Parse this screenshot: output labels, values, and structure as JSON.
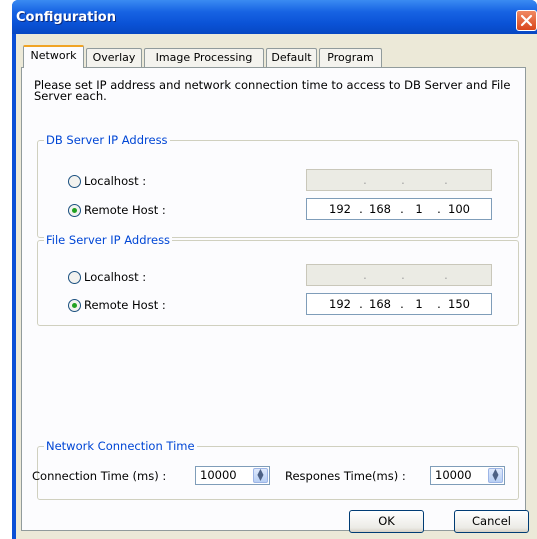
{
  "window": {
    "title": "Configuration"
  },
  "tabs": [
    {
      "label": "Network"
    },
    {
      "label": "Overlay"
    },
    {
      "label": "Image Processing"
    },
    {
      "label": "Default"
    },
    {
      "label": "Program"
    }
  ],
  "network": {
    "description": "Please set IP address and network connection time to access to DB Server and File Server each.",
    "db_server": {
      "group_title": "DB Server IP Address",
      "localhost_label": "Localhost :",
      "remote_label": "Remote Host :",
      "selected": "remote",
      "local_ip": [
        ".",
        ".",
        "."
      ],
      "remote_ip": [
        "192",
        "168",
        "1",
        "100"
      ]
    },
    "file_server": {
      "group_title": "File Server IP Address",
      "localhost_label": "Localhost :",
      "remote_label": "Remote Host :",
      "selected": "remote",
      "local_ip": [
        ".",
        ".",
        "."
      ],
      "remote_ip": [
        "192",
        "168",
        "1",
        "150"
      ]
    },
    "connection": {
      "group_title": "Network Connection Time",
      "connection_label": "Connection Time (ms) :",
      "connection_value": "10000",
      "response_label": "Respones Time(ms) :",
      "response_value": "10000"
    }
  },
  "buttons": {
    "ok": "OK",
    "cancel": "Cancel"
  },
  "icons": {
    "close": "close-icon",
    "spin": "spin-updown-icon",
    "radio": "radio-icon"
  },
  "colors": {
    "titlebar": "#0a52d6",
    "group_title": "#0046d5",
    "tab_highlight": "#f0a424"
  }
}
